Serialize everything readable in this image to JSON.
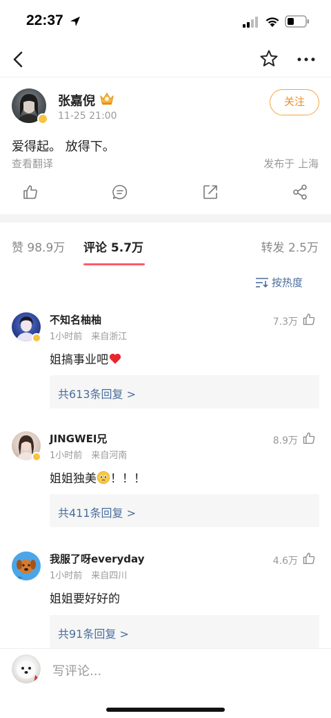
{
  "status_bar": {
    "time": "22:37"
  },
  "post": {
    "author": "张嘉倪",
    "time": "11-25 21:00",
    "follow_label": "关注",
    "text": "爱得起。 放得下。",
    "translate_label": "查看翻译",
    "location": "发布于 上海"
  },
  "tabs": {
    "likes": "赞 98.9万",
    "comments": "评论 5.7万",
    "reposts": "转发 2.5万"
  },
  "sort": {
    "label": "按热度"
  },
  "comments": [
    {
      "name": "不知名柚柚",
      "meta": "1小时前　来自浙江",
      "likes": "7.3万",
      "text": "姐搞事业吧",
      "emoji": "heart-emoji",
      "replies": "共613条回复 >"
    },
    {
      "name": "JINGWEI兄",
      "meta": "1小时前　来自河南",
      "likes": "8.9万",
      "text": "姐姐独美",
      "text_after": "！！！",
      "emoji": "pleading-face-emoji",
      "replies": "共411条回复 >"
    },
    {
      "name": "我服了呀everyday",
      "meta": "1小时前　来自四川",
      "likes": "4.6万",
      "text": "姐姐要好好的",
      "replies": "共91条回复 >"
    }
  ],
  "bottom_bar": {
    "placeholder": "写评论..."
  },
  "colors": {
    "accent_orange": "#f08a1d",
    "tab_underline": "#ff5a6a",
    "link_blue": "#4a6d9c",
    "verified_gold": "#f6c343"
  }
}
